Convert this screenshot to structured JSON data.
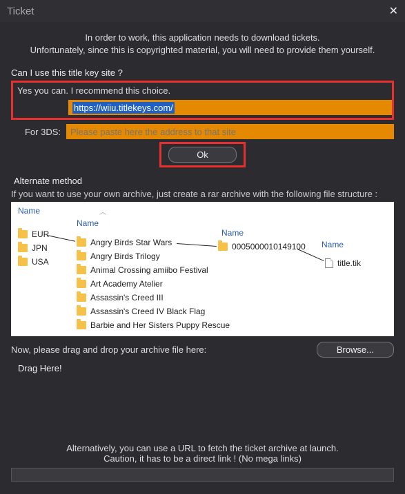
{
  "titlebar": {
    "title": "Ticket"
  },
  "intro": {
    "line1": "In order to work, this application needs to download tickets.",
    "line2": "Unfortunately, since this is copyrighted material, you will need to provide them yourself."
  },
  "titlekey": {
    "question": "Can I use this title key site ?",
    "recommend": "Yes you can. I recommend this choice.",
    "wiiu_url": "https://wiiu.titlekeys.com/",
    "for3ds_label": "For 3DS:",
    "for3ds_placeholder": "Please paste here the address to that site",
    "ok": "Ok"
  },
  "alt": {
    "heading": "Alternate method",
    "desc": "If you want to use your own archive, just create a rar archive with the following file structure :",
    "name_header": "Name",
    "regions": [
      "EUR",
      "JPN",
      "USA"
    ],
    "titles": [
      "Angry Birds Star Wars",
      "Angry Birds Trilogy",
      "Animal Crossing amiibo Festival",
      "Art Academy Atelier",
      "Assassin's Creed III",
      "Assassin's Creed IV Black Flag",
      "Barbie and Her Sisters Puppy Rescue"
    ],
    "title_id": "0005000010149100",
    "tik_file": "title.tik"
  },
  "drag": {
    "label": "Now, please drag and drop your archive file here:",
    "browse": "Browse...",
    "drag_here": "Drag Here!"
  },
  "bottom": {
    "line1": "Alternatively, you can use a URL to fetch the ticket archive at launch.",
    "line2": "Caution, it has to be a direct link ! (No mega links)"
  }
}
